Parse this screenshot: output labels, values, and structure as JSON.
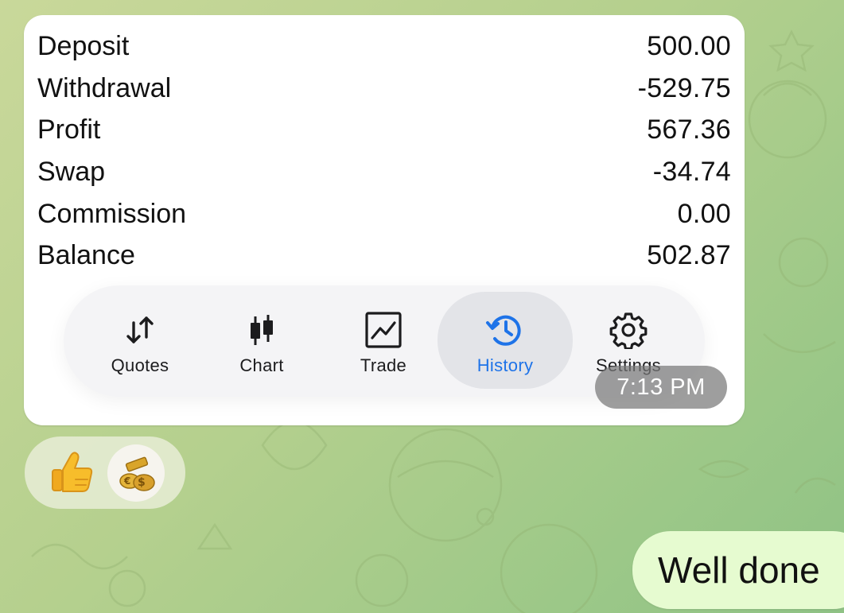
{
  "message": {
    "rows": [
      {
        "label": "Deposit",
        "value": "500.00"
      },
      {
        "label": "Withdrawal",
        "value": "-529.75"
      },
      {
        "label": "Profit",
        "value": "567.36"
      },
      {
        "label": "Swap",
        "value": "-34.74"
      },
      {
        "label": "Commission",
        "value": "0.00"
      },
      {
        "label": "Balance",
        "value": "502.87"
      }
    ],
    "tabs": [
      {
        "label": "Quotes",
        "icon": "quotes-arrows-icon"
      },
      {
        "label": "Chart",
        "icon": "candlestick-icon"
      },
      {
        "label": "Trade",
        "icon": "trade-chart-icon"
      },
      {
        "label": "History",
        "icon": "history-clock-icon",
        "active": true
      },
      {
        "label": "Settings",
        "icon": "gear-icon"
      }
    ],
    "time": "7:13 PM"
  },
  "reactions": {
    "emoji": "thumbs-up-icon",
    "avatar": "gold-money-avatar"
  },
  "outgoing": {
    "text": "Well done"
  },
  "colors": {
    "active_tab": "#1e73e8",
    "outgoing_bubble": "#e6fbd0",
    "background": "#b5d08e"
  }
}
